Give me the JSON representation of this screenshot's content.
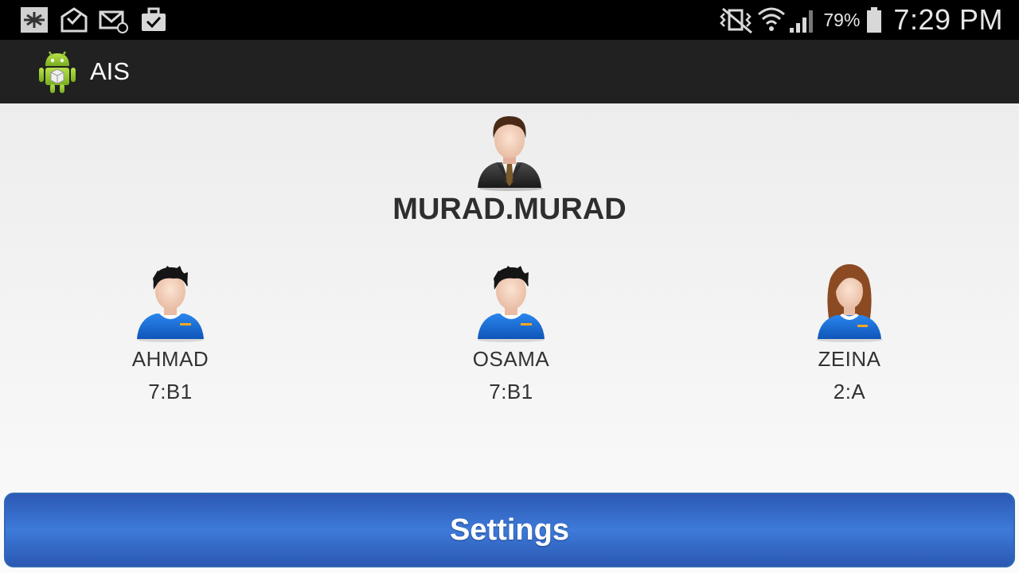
{
  "status_bar": {
    "left_icons": [
      "airplane-notification-icon",
      "mail-check-icon",
      "email-icon",
      "briefcase-check-icon"
    ],
    "right_icons": [
      "vibrate-icon",
      "wifi-icon",
      "signal-icon",
      "battery-icon"
    ],
    "battery_percent": "79%",
    "time": "7:29 PM"
  },
  "action_bar": {
    "app_icon": "android-app-icon",
    "title": "AIS"
  },
  "teacher": {
    "icon": "businessman-avatar-icon",
    "name": "MURAD.MURAD"
  },
  "students": [
    {
      "name": "AHMAD",
      "class": "7:B1",
      "icon": "male-student-avatar-icon"
    },
    {
      "name": "OSAMA",
      "class": "7:B1",
      "icon": "male-student-avatar-icon"
    },
    {
      "name": "ZEINA",
      "class": "2:A",
      "icon": "female-student-avatar-icon"
    }
  ],
  "settings_button": {
    "label": "Settings"
  },
  "colors": {
    "status_bar_bg": "#000000",
    "action_bar_bg": "#212121",
    "button_blue": "#3d7ad9",
    "student_shirt_blue": "#1f6fd6"
  }
}
